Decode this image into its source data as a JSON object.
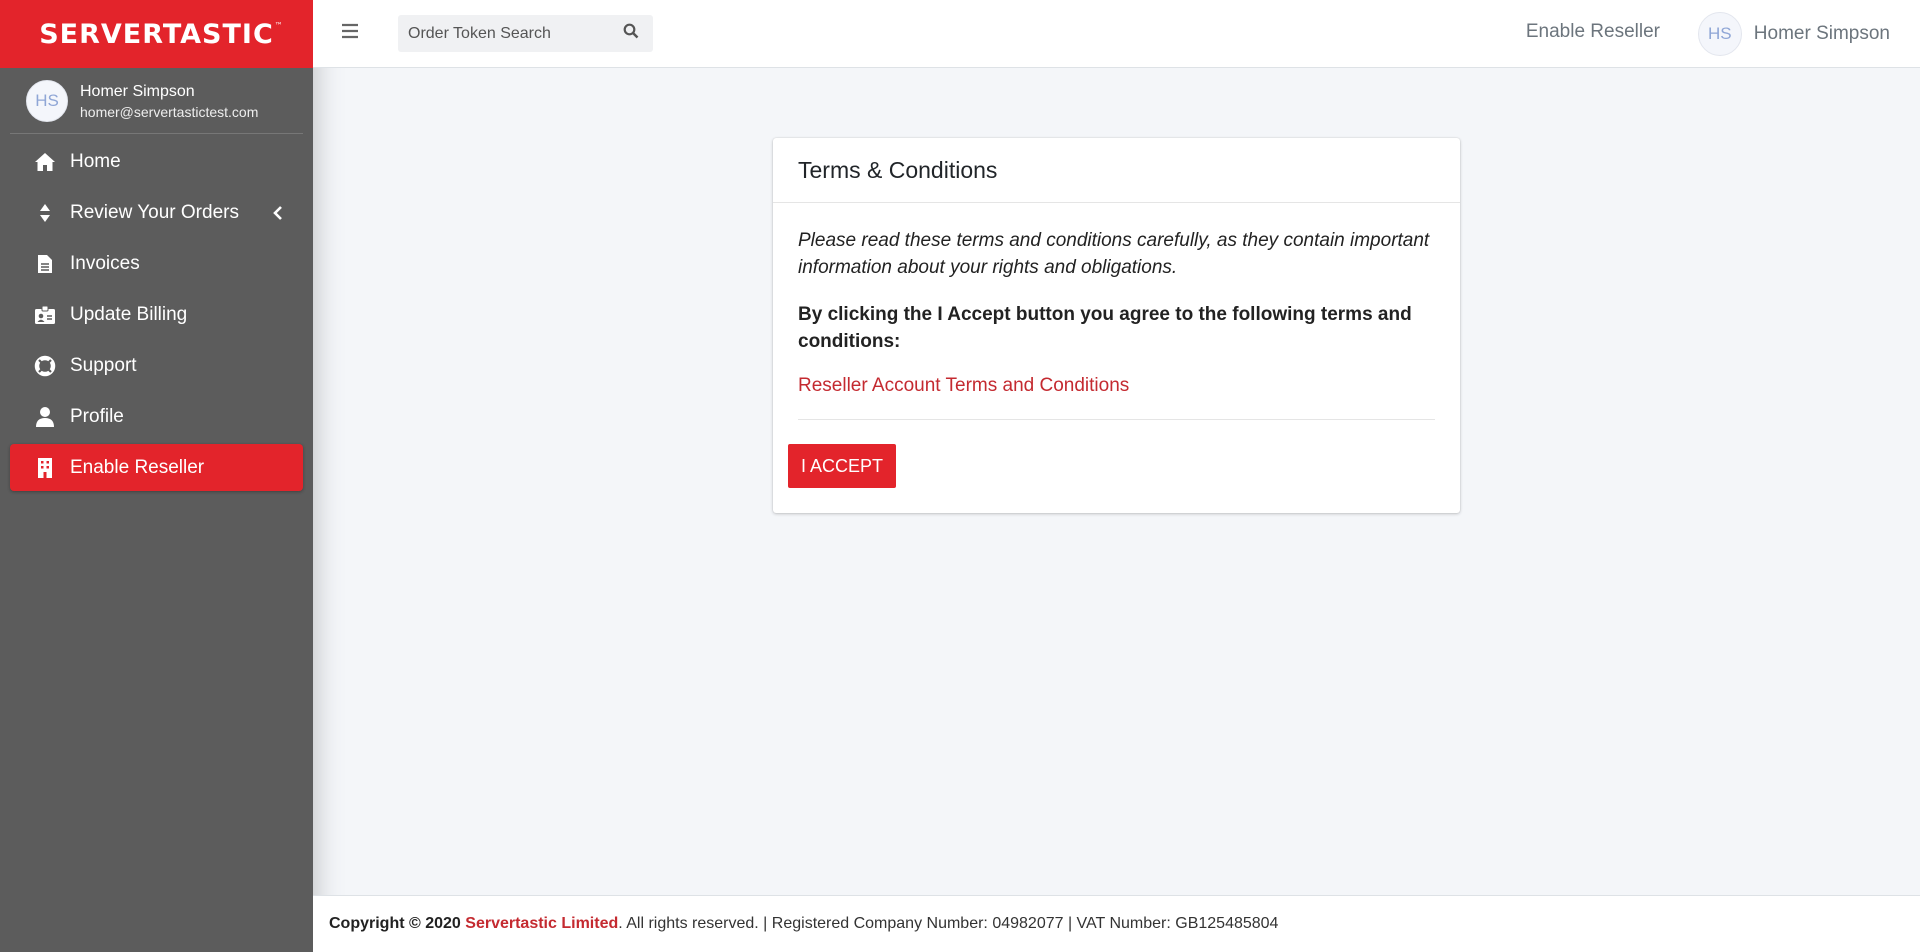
{
  "brand": {
    "name": "SERVERTASTIC",
    "tm": "™"
  },
  "user": {
    "initials": "HS",
    "name": "Homer Simpson",
    "email": "homer@servertastictest.com"
  },
  "sidebar": {
    "items": [
      {
        "label": "Home",
        "icon": "home-icon"
      },
      {
        "label": "Review Your Orders",
        "icon": "sort-icon"
      },
      {
        "label": "Invoices",
        "icon": "file-icon"
      },
      {
        "label": "Update Billing",
        "icon": "id-card-icon"
      },
      {
        "label": "Support",
        "icon": "life-ring-icon"
      },
      {
        "label": "Profile",
        "icon": "user-icon"
      },
      {
        "label": "Enable Reseller",
        "icon": "building-icon",
        "active": true
      }
    ]
  },
  "topbar": {
    "search_placeholder": "Order Token Search",
    "enable_reseller": "Enable Reseller",
    "user_initials": "HS",
    "user_name": "Homer Simpson"
  },
  "card": {
    "title": "Terms & Conditions",
    "intro": "Please read these terms and conditions carefully, as they contain important information about your rights and obligations.",
    "agree": "By clicking the I Accept button you agree to the following terms and conditions:",
    "link": "Reseller Account Terms and Conditions",
    "accept_label": "I ACCEPT"
  },
  "footer": {
    "copyright": "Copyright © 2020",
    "company": "Servertastic Limited",
    "rest": ". All rights reserved. | Registered Company Number: 04982077 | VAT Number: GB125485804"
  },
  "colors": {
    "accent": "#e3242b",
    "sidebar": "#5c5c5c",
    "link": "#c42a30"
  }
}
